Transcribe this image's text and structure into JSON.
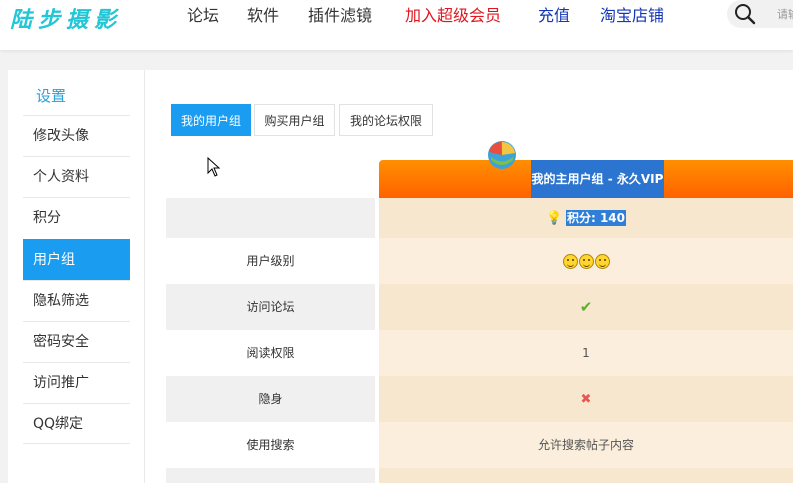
{
  "header": {
    "logo": "陆步摄影",
    "nav": [
      {
        "label": "论坛",
        "color": "#333333"
      },
      {
        "label": "软件",
        "color": "#333333"
      },
      {
        "label": "插件滤镜",
        "color": "#333333"
      },
      {
        "label": "加入超级会员",
        "color": "#e0151e"
      },
      {
        "label": "充值",
        "color": "#1436b8"
      },
      {
        "label": "淘宝店铺",
        "color": "#1436b8"
      }
    ],
    "search_placeholder": "请输"
  },
  "sidebar": {
    "title": "设置",
    "items": [
      {
        "label": "修改头像"
      },
      {
        "label": "个人资料"
      },
      {
        "label": "积分"
      },
      {
        "label": "用户组",
        "active": true
      },
      {
        "label": "隐私筛选"
      },
      {
        "label": "密码安全"
      },
      {
        "label": "访问推广"
      },
      {
        "label": "QQ绑定"
      }
    ]
  },
  "tabs": [
    {
      "label": "我的用户组",
      "active": true
    },
    {
      "label": "购买用户组"
    },
    {
      "label": "我的论坛权限"
    }
  ],
  "group_table": {
    "group_title": "我的主用户组 - 永久VIP",
    "points_label": "积分: 140",
    "rows": [
      {
        "label": "用户级别",
        "value_icon": "smiley-face-icon",
        "value_count": 3
      },
      {
        "label": "访问论坛",
        "value_icon": "checkmark-icon"
      },
      {
        "label": "阅读权限",
        "value": "1"
      },
      {
        "label": "隐身",
        "value_icon": "cross-icon"
      },
      {
        "label": "使用搜索",
        "value": "允许搜索帖子内容"
      }
    ]
  },
  "colors": {
    "accent": "#1a9cf0",
    "vip_header": "#ff7300",
    "vip_label": "#2b74cf",
    "value_cell": "#fbeedc"
  }
}
